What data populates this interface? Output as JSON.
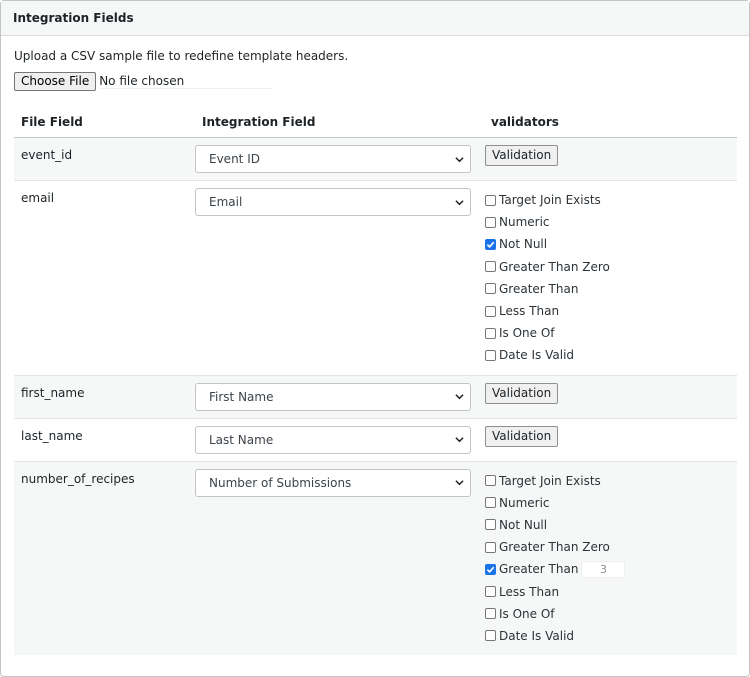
{
  "panel": {
    "title": "Integration Fields"
  },
  "upload": {
    "description": "Upload a CSV sample file to redefine template headers.",
    "button_label": "Choose File",
    "status": "No file chosen"
  },
  "table": {
    "headers": [
      "File Field",
      "Integration Field",
      "validators"
    ],
    "rows": [
      {
        "file_field": "event_id",
        "integration_field": "Event ID",
        "validation_label": "Validation"
      },
      {
        "file_field": "email",
        "integration_field": "Email",
        "validators": [
          {
            "label": "Target Join Exists",
            "checked": false
          },
          {
            "label": "Numeric",
            "checked": false
          },
          {
            "label": "Not Null",
            "checked": true
          },
          {
            "label": "Greater Than Zero",
            "checked": false
          },
          {
            "label": "Greater Than",
            "checked": false
          },
          {
            "label": "Less Than",
            "checked": false
          },
          {
            "label": "Is One Of",
            "checked": false
          },
          {
            "label": "Date Is Valid",
            "checked": false
          }
        ]
      },
      {
        "file_field": "first_name",
        "integration_field": "First Name",
        "validation_label": "Validation"
      },
      {
        "file_field": "last_name",
        "integration_field": "Last Name",
        "validation_label": "Validation"
      },
      {
        "file_field": "number_of_recipes",
        "integration_field": "Number of Submissions",
        "validators": [
          {
            "label": "Target Join Exists",
            "checked": false
          },
          {
            "label": "Numeric",
            "checked": false
          },
          {
            "label": "Not Null",
            "checked": false
          },
          {
            "label": "Greater Than Zero",
            "checked": false
          },
          {
            "label": "Greater Than",
            "checked": true,
            "value": "3"
          },
          {
            "label": "Less Than",
            "checked": false
          },
          {
            "label": "Is One Of",
            "checked": false
          },
          {
            "label": "Date Is Valid",
            "checked": false
          }
        ]
      }
    ]
  },
  "colors": {
    "checkbox_checked": "#1a73e8",
    "row_alt": "#f6f7f7"
  }
}
